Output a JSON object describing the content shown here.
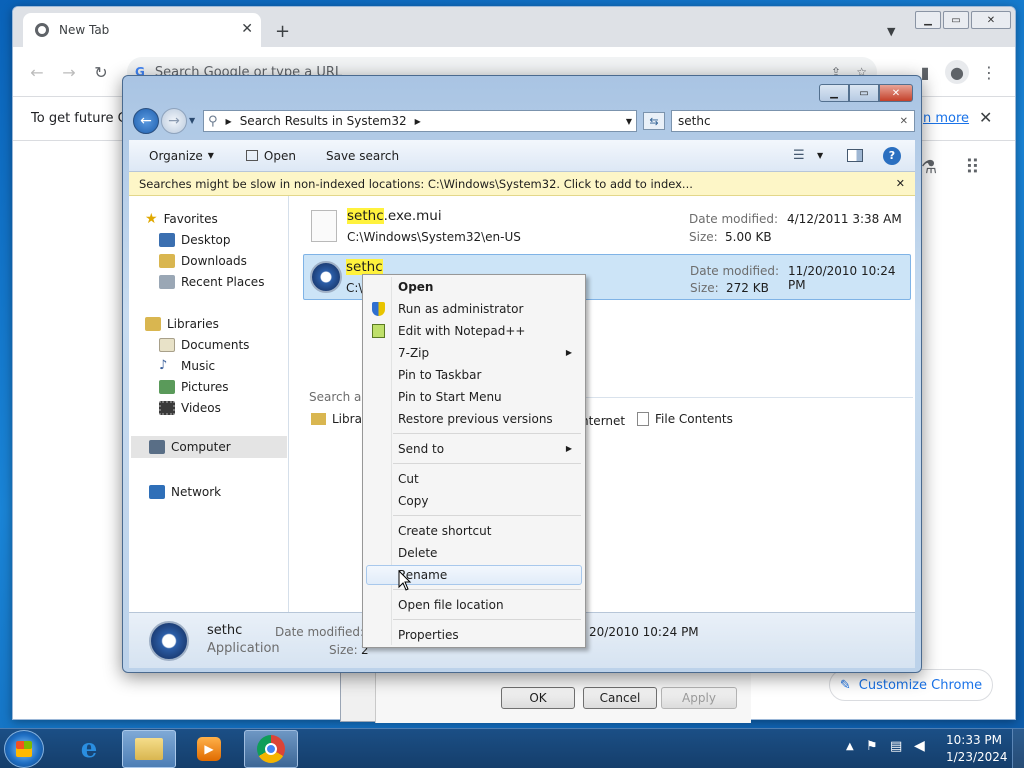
{
  "chrome": {
    "tab_title": "New Tab",
    "omnibox_placeholder": "Search Google or type a URL",
    "infobar_text": "To get future Go",
    "infobar_link": "n more",
    "customize_label": "Customize Chrome"
  },
  "explorer": {
    "breadcrumb": "Search Results in System32",
    "search_value": "sethc",
    "toolbar": {
      "organize": "Organize",
      "open": "Open",
      "save_search": "Save search"
    },
    "notice": "Searches might be slow in non-indexed locations: C:\\Windows\\System32. Click to add to index...",
    "nav": {
      "favorites": "Favorites",
      "favorites_items": [
        "Desktop",
        "Downloads",
        "Recent Places"
      ],
      "libraries": "Libraries",
      "libraries_items": [
        "Documents",
        "Music",
        "Pictures",
        "Videos"
      ],
      "computer": "Computer",
      "network": "Network"
    },
    "results": [
      {
        "name_hl": "sethc",
        "name_rest": ".exe.mui",
        "path": "C:\\Windows\\System32\\en-US",
        "date_label": "Date modified:",
        "date": "4/12/2011 3:38 AM",
        "size_label": "Size:",
        "size": "5.00 KB"
      },
      {
        "name_hl": "sethc",
        "name_rest": "",
        "path": "C:\\",
        "date_label": "Date modified:",
        "date": "11/20/2010 10:24 PM",
        "size_label": "Size:",
        "size": "272 KB"
      }
    ],
    "search_again": "Search aga",
    "search_again_items": {
      "libraries": "Librari",
      "internet": "nternet",
      "file_contents": "File Contents"
    },
    "details": {
      "name": "sethc",
      "type": "Application",
      "date_label": "Date modified: 1",
      "date": "20/2010 10:24 PM",
      "size_label": "Size:",
      "size": "2"
    }
  },
  "context_menu": {
    "items": [
      "Open",
      "Run as administrator",
      "Edit with Notepad++",
      "7-Zip",
      "Pin to Taskbar",
      "Pin to Start Menu",
      "Restore previous versions",
      "Send to",
      "Cut",
      "Copy",
      "Create shortcut",
      "Delete",
      "Rename",
      "Open file location",
      "Properties"
    ]
  },
  "properties_dialog": {
    "ok": "OK",
    "cancel": "Cancel",
    "apply": "Apply"
  },
  "taskbar": {
    "time": "10:33 PM",
    "date": "1/23/2024"
  }
}
